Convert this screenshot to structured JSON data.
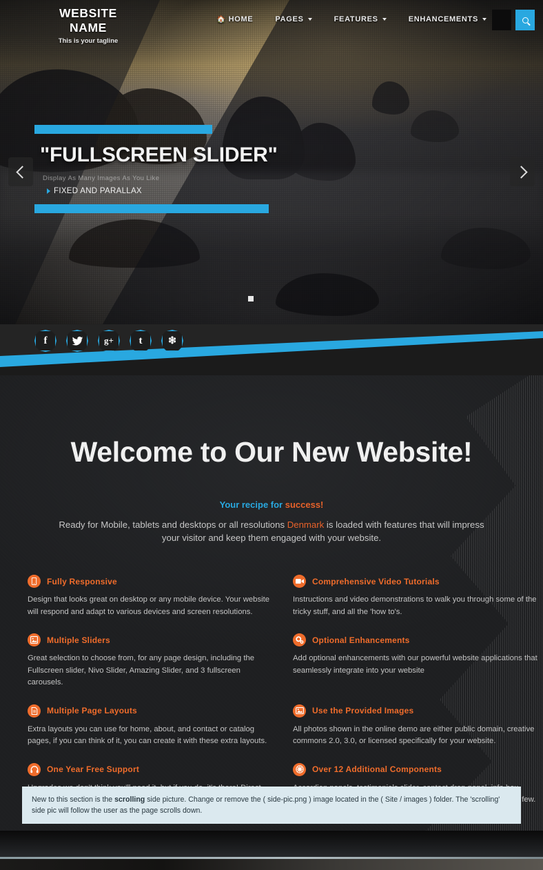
{
  "header": {
    "logo_name": "WEBSITE NAME",
    "tagline": "This is your tagline",
    "nav": [
      {
        "label": "HOME",
        "icon": "home-icon",
        "caret": false
      },
      {
        "label": "PAGES",
        "icon": "",
        "caret": true
      },
      {
        "label": "FEATURES",
        "icon": "",
        "caret": true
      },
      {
        "label": "ENHANCEMENTS",
        "icon": "",
        "caret": true
      }
    ],
    "search_icon": "search-icon",
    "accent_blue": "#29a8e0"
  },
  "slider": {
    "title": "\"FULLSCREEN SLIDER\"",
    "subtitle": "Display As Many Images As You Like",
    "bullet": "FIXED AND PARALLAX",
    "prev_label": "‹",
    "next_label": "›",
    "pagination_count": 1
  },
  "social": [
    {
      "name": "facebook",
      "glyph": "f"
    },
    {
      "name": "twitter",
      "glyph": "ᴠ"
    },
    {
      "name": "google-plus",
      "glyph": "g+"
    },
    {
      "name": "tumblr",
      "glyph": "t"
    },
    {
      "name": "yelp",
      "glyph": "✳"
    }
  ],
  "welcome": {
    "heading": "Welcome to Our New Website!",
    "recipe_part1": "Your recipe for ",
    "recipe_part2": "success!",
    "intro_part1": "Ready for Mobile, tablets and desktops or all resolutions ",
    "intro_highlight": "Denmark",
    "intro_part2": " is loaded with features that will impress your visitor and keep them engaged with your website."
  },
  "features": [
    {
      "icon": "mobile-icon",
      "title": "Fully Responsive",
      "body": "Design that looks great on desktop or any mobile device. Your website will respond and adapt to various devices and screen resolutions."
    },
    {
      "icon": "video-camera-icon",
      "title": "Comprehensive Video Tutorials",
      "body": "Instructions and video demonstrations to walk you through some of the tricky stuff, and all the 'how to's."
    },
    {
      "icon": "slider-image-icon",
      "title": "Multiple Sliders",
      "body": "Great selection to choose from, for any page design, including the Fullscreen slider, Nivo Slider, Amazing Slider, and 3 fullscreen carousels."
    },
    {
      "icon": "gears-icon",
      "title": "Optional Enhancements",
      "body": "Add optional enhancements with our powerful website applications that seamlessly integrate into your website"
    },
    {
      "icon": "document-icon",
      "title": "Multiple Page Layouts",
      "body": "Extra layouts you can use for home, about, and contact or catalog pages, if you can think of it, you can create it with these extra layouts."
    },
    {
      "icon": "picture-icon",
      "title": "Use the Provided Images",
      "body": "All photos shown in the online demo are either public domain, creative commons 2.0, 3.0, or licensed specifically for your website."
    },
    {
      "icon": "headphones-icon",
      "title": "One Year Free Support",
      "body": "Upgrades we don't think you'll need it, but if you do, it's there! Direct contact with the designers and developers!"
    },
    {
      "icon": "asterisk-icon",
      "title": "Over 12 Additional Components",
      "body": "Accordion panels, testimonials slider, contact drop panel, info box carousels, quote rotator, scroll to top and call to actions to name a few."
    }
  ],
  "notice": {
    "part1": "New to this section is the ",
    "bold": "scrolling",
    "part2": " side picture. Change or remove the ( side-pic.png ) image located in the ( Site / images ) folder. The 'scrolling' side pic will follow the user as the page scrolls down."
  }
}
